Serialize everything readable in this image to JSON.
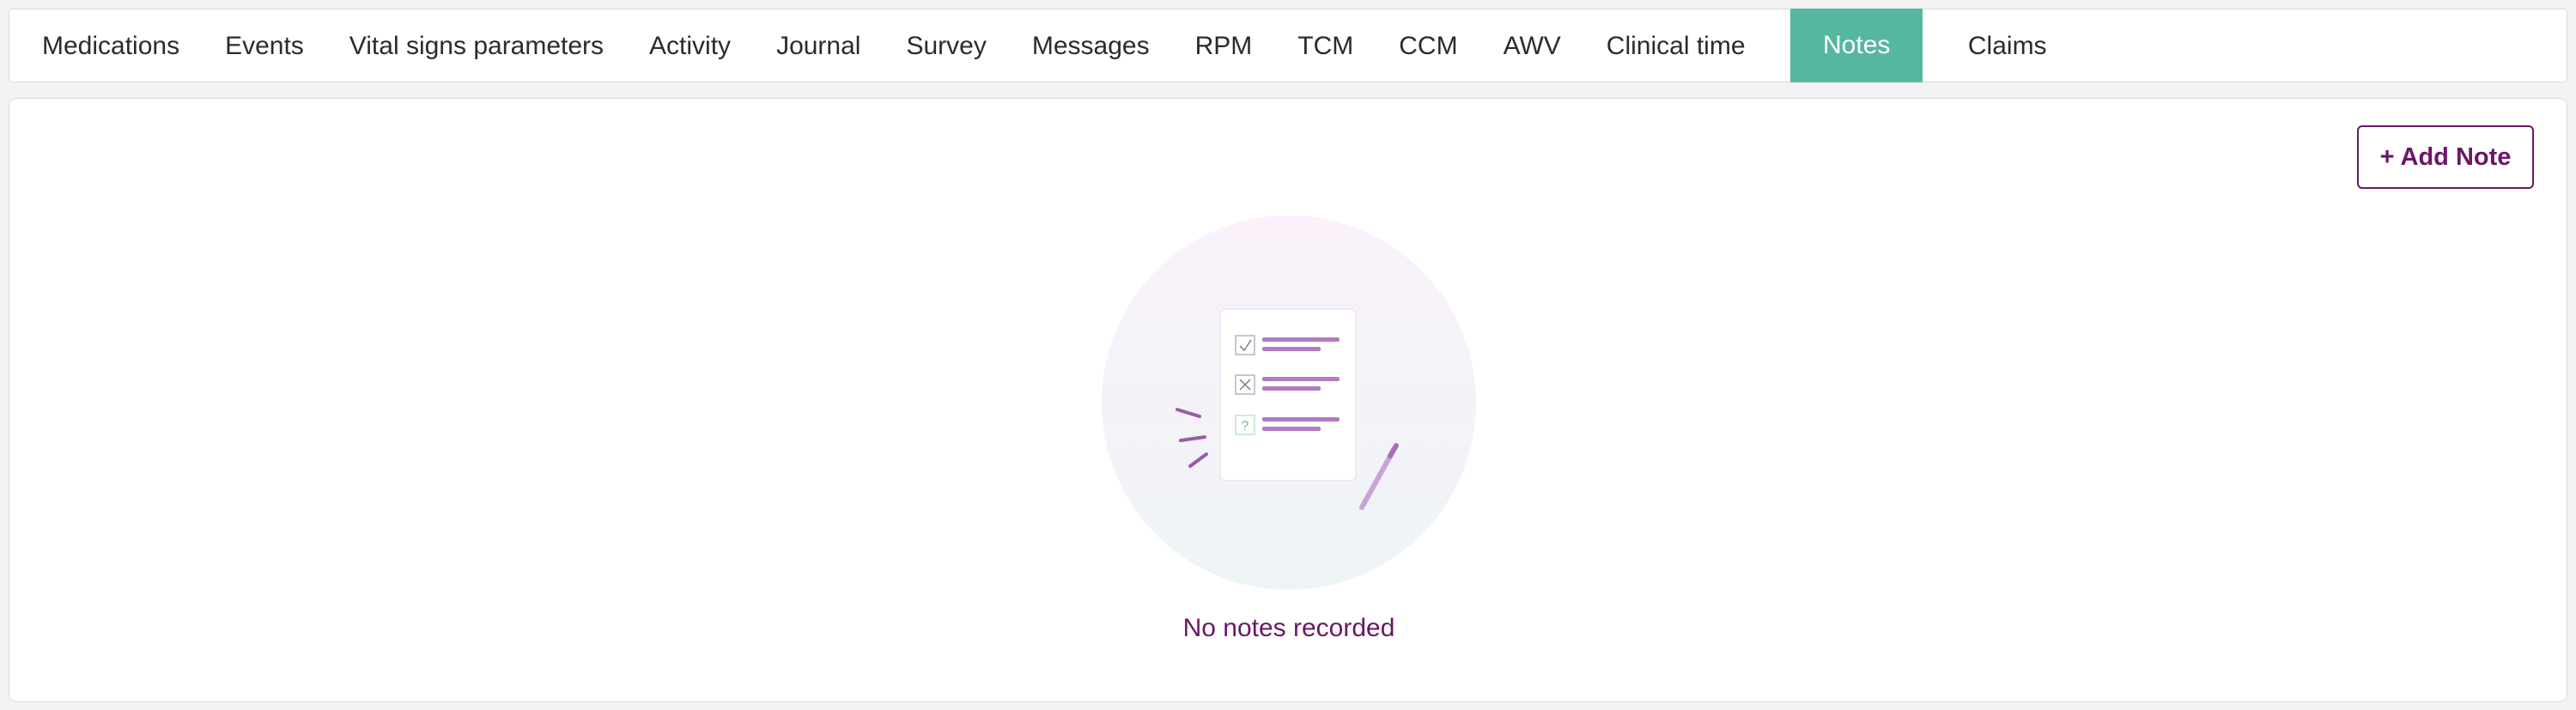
{
  "tabs": [
    {
      "label": "Medications",
      "active": false
    },
    {
      "label": "Events",
      "active": false
    },
    {
      "label": "Vital signs parameters",
      "active": false
    },
    {
      "label": "Activity",
      "active": false
    },
    {
      "label": "Journal",
      "active": false
    },
    {
      "label": "Survey",
      "active": false
    },
    {
      "label": "Messages",
      "active": false
    },
    {
      "label": "RPM",
      "active": false
    },
    {
      "label": "TCM",
      "active": false
    },
    {
      "label": "CCM",
      "active": false
    },
    {
      "label": "AWV",
      "active": false
    },
    {
      "label": "Clinical time",
      "active": false
    },
    {
      "label": "Notes",
      "active": true
    },
    {
      "label": "Claims",
      "active": false
    }
  ],
  "notes_panel": {
    "add_button_label": "+ Add Note",
    "empty_message": "No notes recorded",
    "illustration": {
      "icons": [
        "checkmark-icon",
        "cross-icon",
        "question-icon",
        "pencil-icon"
      ]
    }
  },
  "colors": {
    "active_tab_bg": "#55b7a0",
    "brand_purple": "#6a1766",
    "illustration_line": "#b27cc0"
  }
}
